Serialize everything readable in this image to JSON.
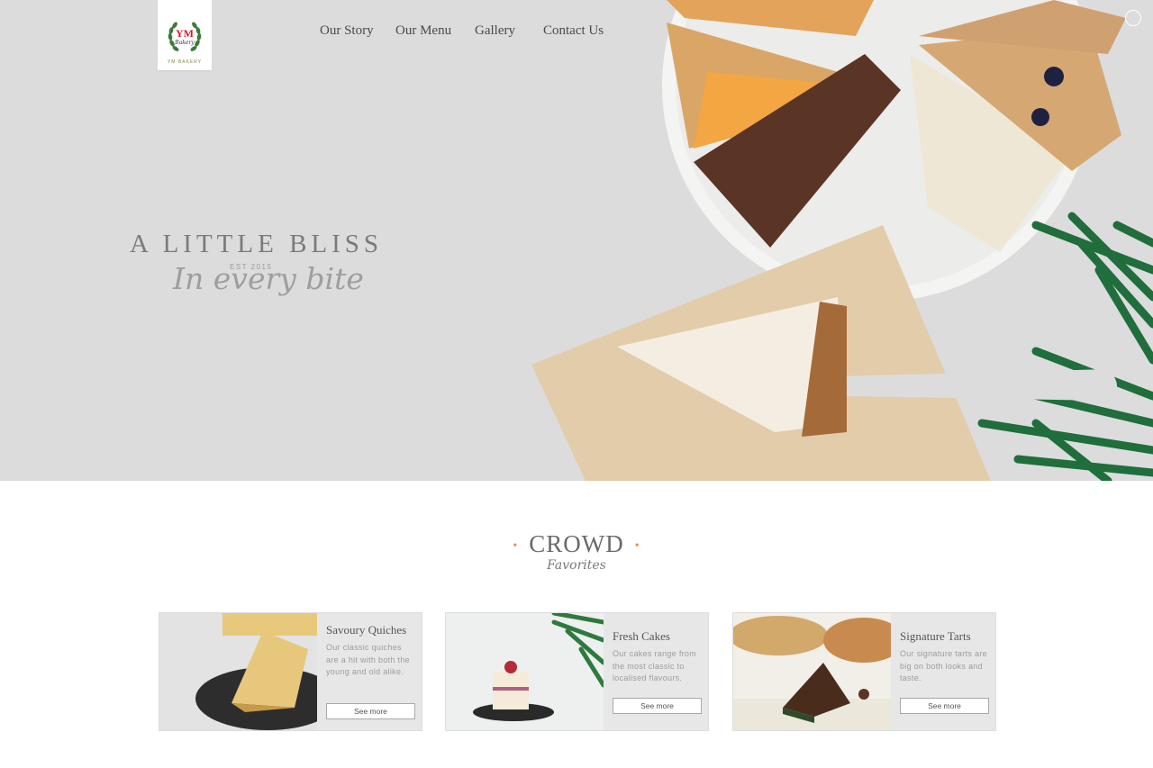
{
  "logo": {
    "monogram": "YM",
    "script": "Bakery",
    "text": "YM BAKERY"
  },
  "nav": {
    "items": [
      "Our Story",
      "Our Menu",
      "Gallery",
      "Contact Us"
    ]
  },
  "hero": {
    "tagline": "A LITTLE BLISS",
    "est": "EST 2015",
    "script": "In every bite"
  },
  "crowd": {
    "title": "CROWD",
    "subtitle": "Favorites"
  },
  "cards": [
    {
      "title": "Savoury Quiches",
      "desc": "Our classic quiches are a hit with both the young and old alike.",
      "button": "See more"
    },
    {
      "title": "Fresh Cakes",
      "desc": "Our cakes range from the most classic to localised flavours.",
      "button": "See more"
    },
    {
      "title": "Signature Tarts",
      "desc": "Our signature tarts are big on both looks and taste.",
      "button": "See more"
    }
  ],
  "colors": {
    "hero_bg": "#dcdcdd",
    "accent": "#e38b55",
    "leaf": "#1f6e3c"
  }
}
